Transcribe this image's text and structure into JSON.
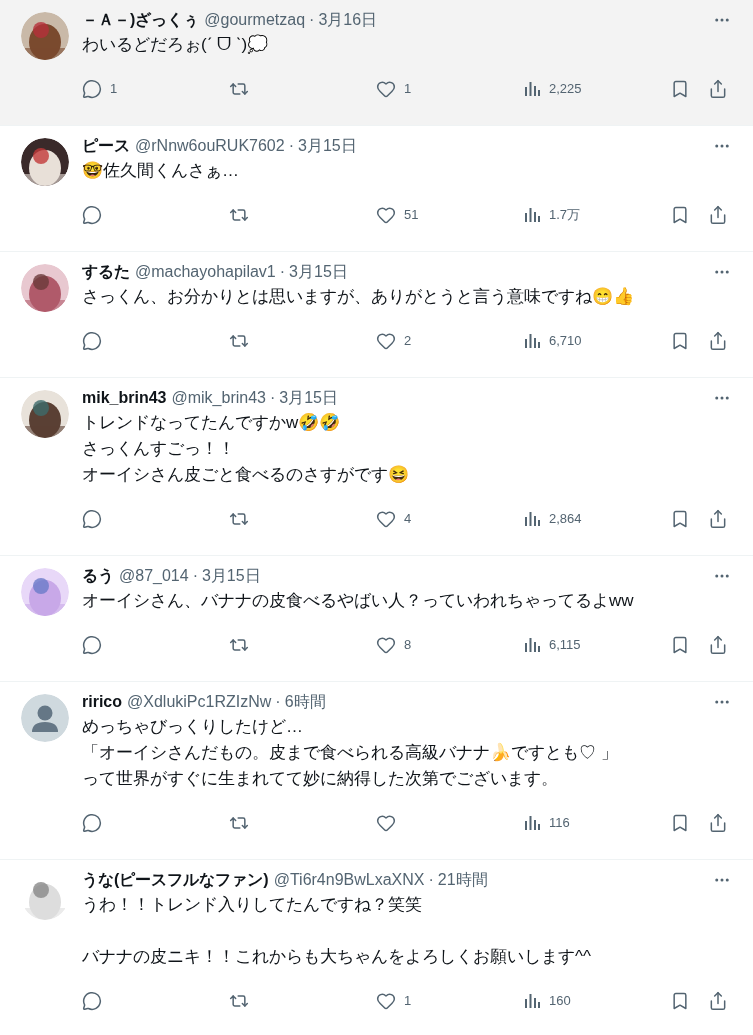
{
  "posts": [
    {
      "avatar": {
        "kind": "picture"
      },
      "name": "－Ａ－)ざっくぅ",
      "handle": "@gourmetzaq",
      "separator": "·",
      "time": "3月16日",
      "highlighted": true,
      "paragraphs": [
        [
          "わいるどだろぉ(ˊ ᗜ ˋ)💭"
        ]
      ],
      "replies": "1",
      "likes": "1",
      "views": "2,225"
    },
    {
      "avatar": {
        "kind": "picture"
      },
      "name": "ピース",
      "handle": "@rNnw6ouRUK7602",
      "separator": "·",
      "time": "3月15日",
      "highlighted": false,
      "paragraphs": [
        [
          "🤓佐久間くんさぁ…"
        ]
      ],
      "likes": "51",
      "views": "1.7万"
    },
    {
      "avatar": {
        "kind": "picture"
      },
      "name": "するた",
      "handle": "@machayohapilav1",
      "separator": "·",
      "time": "3月15日",
      "highlighted": false,
      "paragraphs": [
        [
          "さっくん、お分かりとは思いますが、ありがとうと言う意味ですね😁👍"
        ]
      ],
      "likes": "2",
      "views": "6,710"
    },
    {
      "avatar": {
        "kind": "picture"
      },
      "name": "mik_brin43",
      "handle": "@mik_brin43",
      "separator": "·",
      "time": "3月15日",
      "highlighted": false,
      "paragraphs": [
        [
          "トレンドなってたんですかw🤣🤣",
          "さっくんすごっ！！",
          "オーイシさん皮ごと食べるのさすがです😆"
        ]
      ],
      "likes": "4",
      "views": "2,864"
    },
    {
      "avatar": {
        "kind": "picture"
      },
      "name": "るう",
      "handle": "@87_014",
      "separator": "·",
      "time": "3月15日",
      "highlighted": false,
      "paragraphs": [
        [
          "オーイシさん、バナナの皮食べるやばい人？っていわれちゃってるよww"
        ]
      ],
      "likes": "8",
      "views": "6,115"
    },
    {
      "avatar": {
        "kind": "default"
      },
      "name": "ririco",
      "handle": "@XdlukiPc1RZIzNw",
      "separator": "·",
      "time": "6時間",
      "highlighted": false,
      "paragraphs": [
        [
          "めっちゃびっくりしたけど…",
          "「オーイシさんだもの。皮まで食べられる高級バナナ🍌ですとも♡ 」",
          "って世界がすぐに生まれてて妙に納得した次第でございます。"
        ]
      ],
      "views": "116"
    },
    {
      "avatar": {
        "kind": "picture"
      },
      "name": "うな(ピースフルなファン)",
      "handle": "@Ti6r4n9BwLxaXNX",
      "separator": "·",
      "time": "21時間",
      "highlighted": false,
      "paragraphs": [
        [
          "うわ！！トレンド入りしてたんですね？笑笑"
        ],
        [
          "バナナの皮ニキ！！これからも大ちゃんをよろしくお願いします^^"
        ]
      ],
      "likes": "1",
      "views": "160"
    }
  ]
}
